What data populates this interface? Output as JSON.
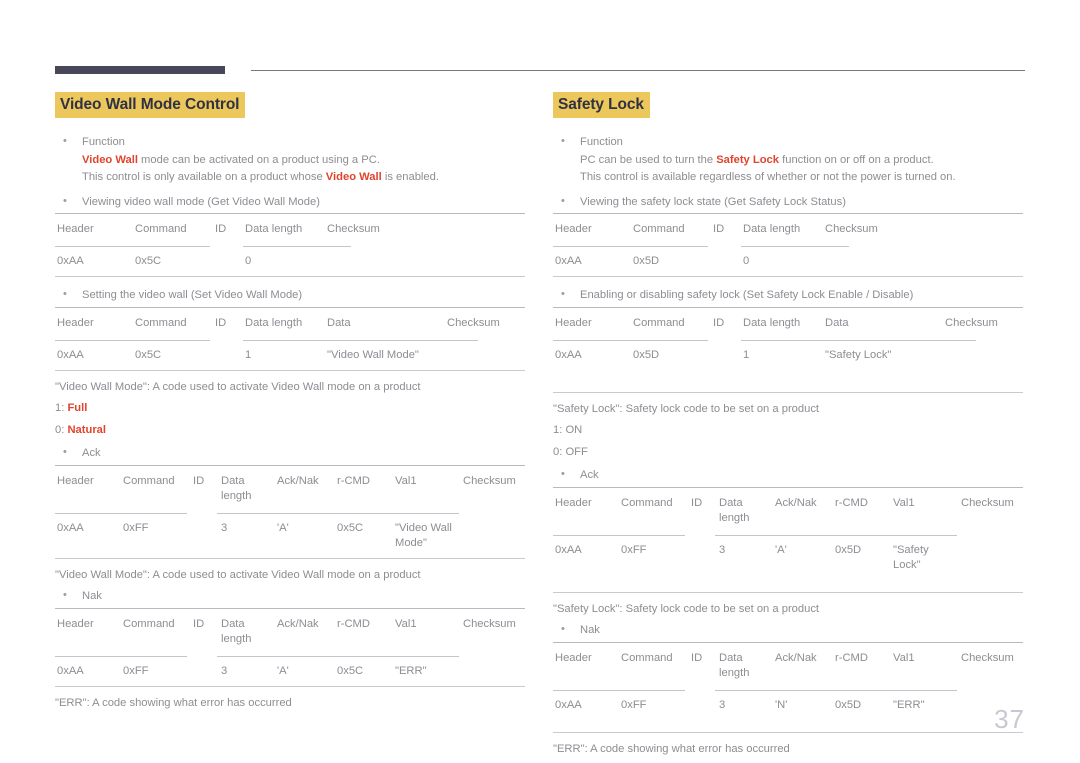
{
  "page": {
    "number": "37"
  },
  "left": {
    "title": "Video Wall Mode Control",
    "function_label": "Function",
    "function_line1_pre": "",
    "function_line1_accent": "Video Wall",
    "function_line1_post": " mode can be activated on a product using a PC.",
    "function_line2_pre": "This control is only available on a product whose ",
    "function_line2_accent": "Video Wall",
    "function_line2_post": " is enabled.",
    "get_bullet": "Viewing video wall mode (Get Video Wall Mode)",
    "get_table": {
      "headers": [
        "Header",
        "Command",
        "ID",
        "Data length",
        "Checksum"
      ],
      "rows": [
        [
          "0xAA",
          "0x5C",
          "",
          "0",
          ""
        ]
      ]
    },
    "set_bullet": "Setting the video wall (Set Video Wall Mode)",
    "set_table": {
      "headers": [
        "Header",
        "Command",
        "ID",
        "Data length",
        "Data",
        "Checksum"
      ],
      "rows": [
        [
          "0xAA",
          "0x5C",
          "",
          "1",
          "\"Video Wall Mode\"",
          ""
        ]
      ]
    },
    "note_code": "\"Video Wall Mode\": A code used to activate Video Wall mode on a product",
    "val_1_prefix": "1: ",
    "val_1_accent": "Full",
    "val_0_prefix": "0: ",
    "val_0_accent": "Natural",
    "ack_bullet": "Ack",
    "ack_table": {
      "headers": [
        "Header",
        "Command",
        "ID",
        "Data length",
        "Ack/Nak",
        "r-CMD",
        "Val1",
        "Checksum"
      ],
      "rows": [
        [
          "0xAA",
          "0xFF",
          "",
          "3",
          "'A'",
          "0x5C",
          "\"Video Wall Mode\"",
          ""
        ]
      ]
    },
    "note_code_2": "\"Video Wall Mode\": A code used to activate Video Wall mode on a product",
    "nak_bullet": "Nak",
    "nak_table": {
      "headers": [
        "Header",
        "Command",
        "ID",
        "Data length",
        "Ack/Nak",
        "r-CMD",
        "Val1",
        "Checksum"
      ],
      "rows": [
        [
          "0xAA",
          "0xFF",
          "",
          "3",
          "'A'",
          "0x5C",
          "\"ERR\"",
          ""
        ]
      ]
    },
    "note_err": "\"ERR\": A code showing what error has occurred"
  },
  "right": {
    "title": "Safety Lock",
    "function_label": "Function",
    "function_line1_pre": "PC can be used to turn the ",
    "function_line1_accent": "Safety Lock",
    "function_line1_post": " function on or off on a product.",
    "function_line2": "This control is available regardless of whether or not the power is turned on.",
    "get_bullet": "Viewing the safety lock state (Get Safety Lock Status)",
    "get_table": {
      "headers": [
        "Header",
        "Command",
        "ID",
        "Data length",
        "Checksum"
      ],
      "rows": [
        [
          "0xAA",
          "0x5D",
          "",
          "0",
          ""
        ]
      ]
    },
    "set_bullet": "Enabling or disabling safety lock (Set Safety Lock Enable / Disable)",
    "set_table": {
      "headers": [
        "Header",
        "Command",
        "ID",
        "Data length",
        "Data",
        "Checksum"
      ],
      "rows": [
        [
          "0xAA",
          "0x5D",
          "",
          "1",
          "\"Safety Lock\"",
          ""
        ]
      ]
    },
    "note_code": "\"Safety Lock\": Safety lock code to be set on a product",
    "val_1": "1: ON",
    "val_0": "0: OFF",
    "ack_bullet": "Ack",
    "ack_table": {
      "headers": [
        "Header",
        "Command",
        "ID",
        "Data length",
        "Ack/Nak",
        "r-CMD",
        "Val1",
        "Checksum"
      ],
      "rows": [
        [
          "0xAA",
          "0xFF",
          "",
          "3",
          "'A'",
          "0x5D",
          "\"Safety Lock\"",
          ""
        ]
      ]
    },
    "note_code_2": "\"Safety Lock\": Safety lock code to be set on a product",
    "nak_bullet": "Nak",
    "nak_table": {
      "headers": [
        "Header",
        "Command",
        "ID",
        "Data length",
        "Ack/Nak",
        "r-CMD",
        "Val1",
        "Checksum"
      ],
      "rows": [
        [
          "0xAA",
          "0xFF",
          "",
          "3",
          "'N'",
          "0x5D",
          "\"ERR\"",
          ""
        ]
      ]
    },
    "note_err": "\"ERR\": A code showing what error has occurred"
  },
  "colors": {
    "accent": "#e0442c",
    "highlight": "#ecc75c",
    "header_bar": "#474759",
    "body_text": "#8d8d93",
    "rule": "#b9b9bf",
    "page_number": "#c8c8d2"
  }
}
